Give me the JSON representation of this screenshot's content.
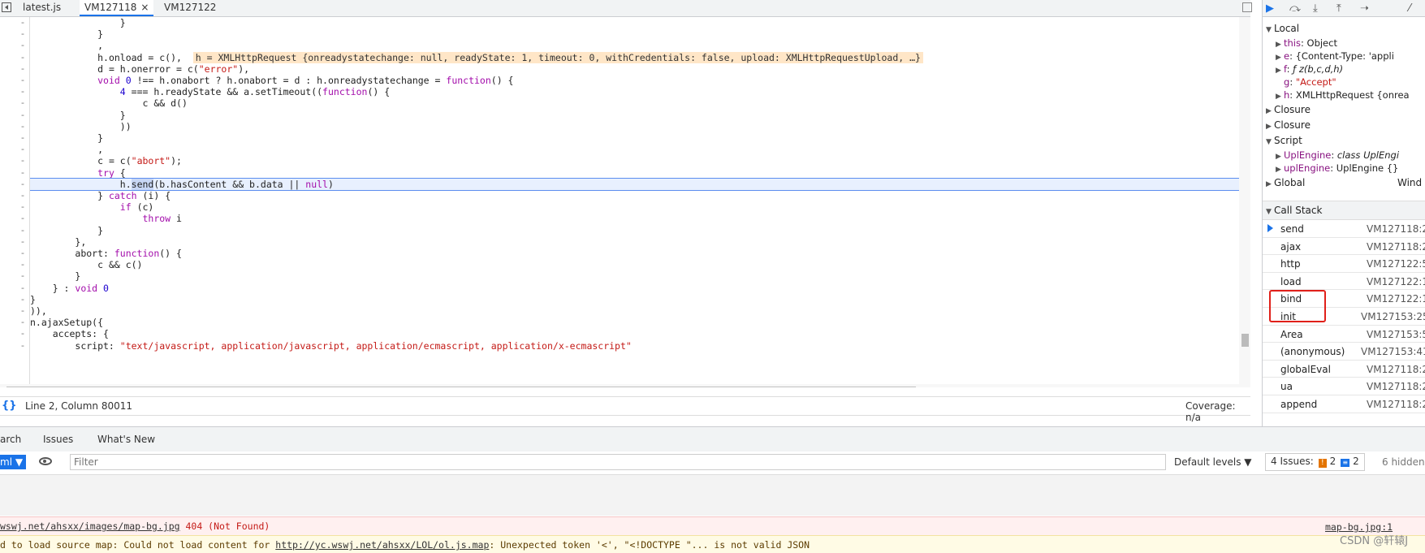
{
  "tabs": [
    {
      "label": "latest.js",
      "active": false
    },
    {
      "label": "VM127118",
      "active": true,
      "close": "×"
    },
    {
      "label": "VM127122",
      "active": false
    }
  ],
  "code": {
    "lines": [
      {
        "indent": "                ",
        "segments": [
          [
            "p",
            "}"
          ]
        ]
      },
      {
        "indent": "            ",
        "segments": [
          [
            "p",
            "}"
          ]
        ]
      },
      {
        "indent": "            ",
        "segments": [
          [
            "p",
            ","
          ]
        ]
      },
      {
        "indent": "            ",
        "segments": [
          [
            "p",
            "h.onload = c(),  "
          ],
          [
            "v",
            "h = XMLHttpRequest {onreadystatechange: null, readyState: 1, timeout: 0, withCredentials: false, upload: XMLHttpRequestUpload, …}"
          ]
        ]
      },
      {
        "indent": "            ",
        "segments": [
          [
            "p",
            "d = h.onerror = c("
          ],
          [
            "s",
            "\"error\""
          ],
          [
            "p",
            "),"
          ]
        ]
      },
      {
        "indent": "            ",
        "segments": [
          [
            "k",
            "void "
          ],
          [
            "n",
            "0"
          ],
          [
            "p",
            " !== h.onabort ? h.onabort = d : h.onreadystatechange = "
          ],
          [
            "k",
            "function"
          ],
          [
            "p",
            "() {"
          ]
        ]
      },
      {
        "indent": "                ",
        "segments": [
          [
            "n",
            "4"
          ],
          [
            "p",
            " === h.readyState && a.setTimeout(("
          ],
          [
            "k",
            "function"
          ],
          [
            "p",
            "() {"
          ]
        ]
      },
      {
        "indent": "                    ",
        "segments": [
          [
            "p",
            "c && d()"
          ]
        ]
      },
      {
        "indent": "                ",
        "segments": [
          [
            "p",
            "}"
          ]
        ]
      },
      {
        "indent": "                ",
        "segments": [
          [
            "p",
            "))"
          ]
        ]
      },
      {
        "indent": "            ",
        "segments": [
          [
            "p",
            "}"
          ]
        ]
      },
      {
        "indent": "            ",
        "segments": [
          [
            "p",
            ","
          ]
        ]
      },
      {
        "indent": "            ",
        "segments": [
          [
            "p",
            "c = c("
          ],
          [
            "s",
            "\"abort\""
          ],
          [
            "p",
            ");"
          ]
        ]
      },
      {
        "indent": "            ",
        "segments": [
          [
            "k",
            "try"
          ],
          [
            "p",
            " {"
          ]
        ]
      },
      {
        "indent": "                ",
        "current": true,
        "segments": [
          [
            "p",
            "h."
          ],
          [
            "h",
            "send"
          ],
          [
            "p",
            "(b.hasContent && b.data || "
          ],
          [
            "k",
            "null"
          ],
          [
            "p",
            ")"
          ]
        ]
      },
      {
        "indent": "            ",
        "segments": [
          [
            "p",
            "} "
          ],
          [
            "k",
            "catch"
          ],
          [
            "p",
            " (i) {"
          ]
        ]
      },
      {
        "indent": "                ",
        "segments": [
          [
            "k",
            "if"
          ],
          [
            "p",
            " (c)"
          ]
        ]
      },
      {
        "indent": "                    ",
        "segments": [
          [
            "k",
            "throw"
          ],
          [
            "p",
            " i"
          ]
        ]
      },
      {
        "indent": "            ",
        "segments": [
          [
            "p",
            "}"
          ]
        ]
      },
      {
        "indent": "        ",
        "segments": [
          [
            "p",
            "},"
          ]
        ]
      },
      {
        "indent": "        ",
        "segments": [
          [
            "p",
            "abort: "
          ],
          [
            "k",
            "function"
          ],
          [
            "p",
            "() {"
          ]
        ]
      },
      {
        "indent": "            ",
        "segments": [
          [
            "p",
            "c && c()"
          ]
        ]
      },
      {
        "indent": "        ",
        "segments": [
          [
            "p",
            "}"
          ]
        ]
      },
      {
        "indent": "    ",
        "segments": [
          [
            "p",
            "} : "
          ],
          [
            "k",
            "void "
          ],
          [
            "n",
            "0"
          ]
        ]
      },
      {
        "indent": "",
        "segments": [
          [
            "p",
            "}"
          ]
        ]
      },
      {
        "indent": "",
        "segments": [
          [
            "p",
            ")),"
          ]
        ]
      },
      {
        "indent": "",
        "segments": [
          [
            "p",
            "n.ajaxSetup({"
          ]
        ]
      },
      {
        "indent": "    ",
        "segments": [
          [
            "p",
            "accepts: {"
          ]
        ]
      },
      {
        "indent": "        ",
        "segments": [
          [
            "p",
            "script: "
          ],
          [
            "s",
            "\"text/javascript, application/javascript, application/ecmascript, application/x-ecmascript\""
          ]
        ]
      }
    ],
    "gutter_mark": "-"
  },
  "status": {
    "braces": "{}",
    "position": "Line 2, Column 80011",
    "coverage": "Coverage: n/a"
  },
  "scope": {
    "local_label": "Local",
    "vars": [
      {
        "key": "this",
        "value": "Object",
        "expandable": true
      },
      {
        "key": "e",
        "value": "{Content-Type: 'appli",
        "expandable": true
      },
      {
        "key": "f",
        "value": "ƒ z(b,c,d,h)",
        "expandable": true
      },
      {
        "key": "g",
        "value": "\"Accept\"",
        "expandable": false,
        "string": true
      },
      {
        "key": "h",
        "value": "XMLHttpRequest {onrea",
        "expandable": true
      }
    ],
    "closure1": "Closure",
    "closure2": "Closure",
    "script_label": "Script",
    "script_vars": [
      {
        "key": "UplEngine",
        "value": "class UplEngi"
      },
      {
        "key": "uplEngine",
        "value": "UplEngine {}"
      }
    ],
    "global_label": "Global",
    "global_value": "Wind"
  },
  "callstack": {
    "label": "Call Stack",
    "frames": [
      {
        "fn": "send",
        "loc": "VM127118:2",
        "current": true
      },
      {
        "fn": "ajax",
        "loc": "VM127118:2"
      },
      {
        "fn": "http",
        "loc": "VM127122:5"
      },
      {
        "fn": "load",
        "loc": "VM127122:1"
      },
      {
        "fn": "bind",
        "loc": "VM127122:1"
      },
      {
        "fn": "init",
        "loc": "VM127153:25"
      },
      {
        "fn": "Area",
        "loc": "VM127153:5"
      },
      {
        "fn": "(anonymous)",
        "loc": "VM127153:41"
      },
      {
        "fn": "globalEval",
        "loc": "VM127118:2"
      },
      {
        "fn": "ua",
        "loc": "VM127118:2"
      },
      {
        "fn": "append",
        "loc": "VM127118:2"
      }
    ]
  },
  "drawer": {
    "tabs": [
      "arch",
      "Issues",
      "What's New"
    ],
    "context": "ml",
    "filter_placeholder": "Filter",
    "levels": "Default levels ▼",
    "issues_label": "4 Issues:",
    "issues_warn": "2",
    "issues_info": "2",
    "hidden": "6 hidden"
  },
  "messages": {
    "e404_url": "wswj.net/ahsxx/images/map-bg.jpg",
    "e404_status": " 404 (Not Found)",
    "e404_src": "map-bg.jpg:1",
    "map_prefix": "d to load source map: Could not load content for ",
    "map_url": "http://yc.wswj.net/ahsxx/LOL/ol.js.map",
    "map_suffix": ": Unexpected token '<', \"<!DOCTYPE \"... is not valid JSON"
  },
  "watermark": "CSDN @轩辕J"
}
